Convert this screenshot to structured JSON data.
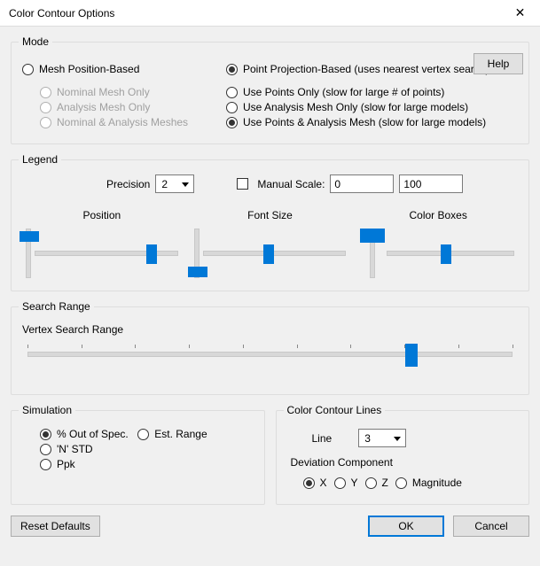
{
  "window": {
    "title": "Color Contour Options"
  },
  "help": {
    "label": "Help"
  },
  "mode": {
    "legend": "Mode",
    "mesh_based": "Mesh Position-Based",
    "point_based": "Point Projection-Based (uses nearest vertex search)",
    "nominal_only": "Nominal Mesh Only",
    "analysis_only": "Analysis Mesh Only",
    "both_meshes": "Nominal & Analysis Meshes",
    "points_only": "Use Points Only (slow for large # of points)",
    "analysis_mesh_only": "Use Analysis Mesh Only (slow for large models)",
    "points_and_mesh": "Use Points & Analysis Mesh (slow for large models)"
  },
  "legend_section": {
    "legend": "Legend",
    "precision_label": "Precision",
    "precision_value": "2",
    "manual_scale_label": "Manual Scale:",
    "scale_min": "0",
    "scale_max": "100",
    "slider_position": "Position",
    "slider_fontsize": "Font Size",
    "slider_colorboxes": "Color Boxes"
  },
  "search": {
    "legend": "Search Range",
    "vsr_label": "Vertex Search Range"
  },
  "simulation": {
    "legend": "Simulation",
    "pct_out": "% Out of Spec.",
    "est_range": "Est. Range",
    "n_std": "'N' STD",
    "ppk": "Ppk"
  },
  "ccl": {
    "legend": "Color Contour Lines",
    "line_label": "Line",
    "line_value": "3",
    "dev_label": "Deviation Component",
    "x": "X",
    "y": "Y",
    "z": "Z",
    "mag": "Magnitude"
  },
  "buttons": {
    "reset": "Reset Defaults",
    "ok": "OK",
    "cancel": "Cancel"
  }
}
